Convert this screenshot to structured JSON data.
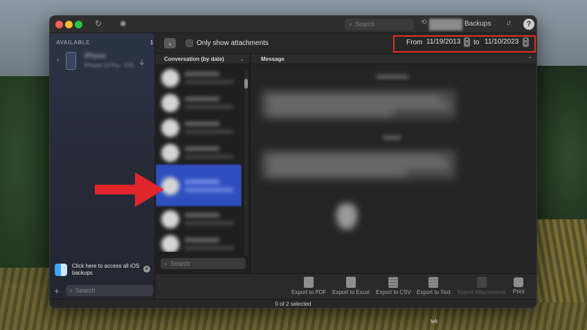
{
  "window": {
    "sidebar": {
      "section_title": "AVAILABLE",
      "section_count": "1",
      "device": {
        "name": "iPhone",
        "subtitle": "iPhone 13 Pro · iOS",
        "icon": "usb-icon"
      },
      "promo_text": "Click here to access all iOS backups",
      "search_placeholder": "Search",
      "add_label": "+"
    },
    "titlebar": {
      "search_placeholder": "Search",
      "backups_label": "Backups",
      "sort_label": "↓↑",
      "help_label": "?"
    },
    "subbar": {
      "only_attachments_label": "Only show attachments",
      "from_label": "From",
      "from_date": "11/19/2013",
      "to_label": "to",
      "to_date": "11/10/2023",
      "highlight_color": "#e0321f"
    },
    "conversations": {
      "header": "Conversation (by date)",
      "search_placeholder": "Search",
      "selected_index": 4,
      "row_count": 8
    },
    "message_pane": {
      "header": "Message"
    },
    "export_toolbar": {
      "items": [
        {
          "label": "Export to PDF",
          "icon": "pdf-icon",
          "enabled": true
        },
        {
          "label": "Export to Excel",
          "icon": "excel-icon",
          "enabled": true
        },
        {
          "label": "Export to CSV",
          "icon": "csv-icon",
          "enabled": true
        },
        {
          "label": "Export to Text",
          "icon": "text-icon",
          "enabled": true
        },
        {
          "label": "Export Attachments",
          "icon": "attachment-icon",
          "enabled": false
        },
        {
          "label": "Print",
          "icon": "print-icon",
          "enabled": true
        }
      ]
    },
    "status": "0 of 2 selected"
  },
  "annotation": {
    "arrow_color": "#e0262b"
  },
  "watermark": "ᴍk"
}
